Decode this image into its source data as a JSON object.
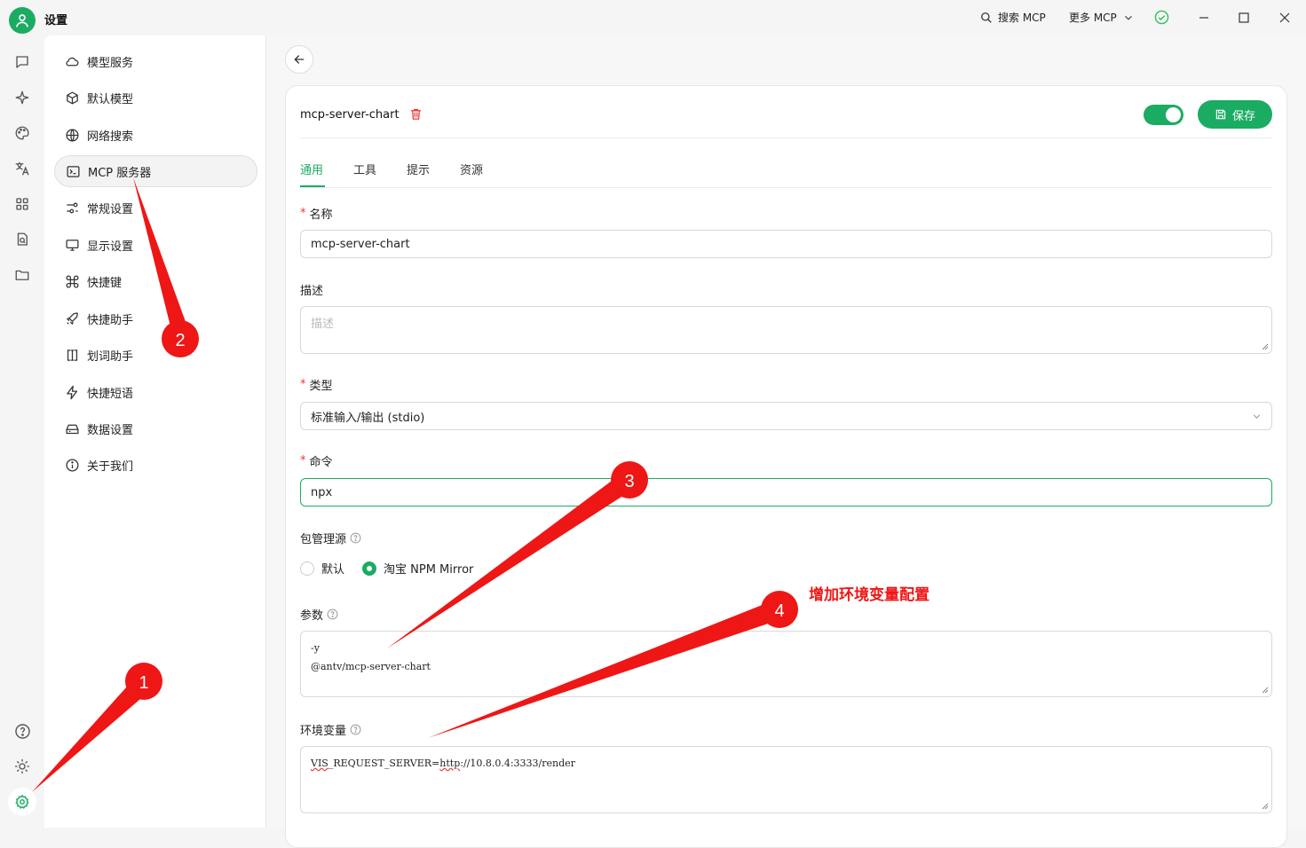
{
  "titlebar": {
    "app_title": "设置",
    "search_mcp": "搜索 MCP",
    "more_mcp": "更多 MCP"
  },
  "settings_nav": {
    "items": [
      {
        "label": "模型服务",
        "icon": "cloud-icon"
      },
      {
        "label": "默认模型",
        "icon": "cube-icon"
      },
      {
        "label": "网络搜索",
        "icon": "globe-icon"
      },
      {
        "label": "MCP 服务器",
        "icon": "terminal-icon"
      },
      {
        "label": "常规设置",
        "icon": "sliders-icon"
      },
      {
        "label": "显示设置",
        "icon": "monitor-icon"
      },
      {
        "label": "快捷键",
        "icon": "command-icon"
      },
      {
        "label": "快捷助手",
        "icon": "rocket-icon"
      },
      {
        "label": "划词助手",
        "icon": "text-cursor-icon"
      },
      {
        "label": "快捷短语",
        "icon": "zap-icon"
      },
      {
        "label": "数据设置",
        "icon": "drive-icon"
      },
      {
        "label": "关于我们",
        "icon": "info-icon"
      }
    ],
    "active_index": 3
  },
  "server": {
    "name": "mcp-server-chart",
    "enabled": true,
    "save_label": "保存"
  },
  "tabs": [
    "通用",
    "工具",
    "提示",
    "资源"
  ],
  "form": {
    "name_label": "名称",
    "name_value": "mcp-server-chart",
    "desc_label": "描述",
    "desc_placeholder": "描述",
    "type_label": "类型",
    "type_value": "标准输入/输出 (stdio)",
    "command_label": "命令",
    "command_value": "npx",
    "pkg_label": "包管理源",
    "pkg_options": [
      "默认",
      "淘宝 NPM Mirror"
    ],
    "pkg_selected": "淘宝 NPM Mirror",
    "args_label": "参数",
    "args_lines": [
      "-y",
      "@antv/mcp-server-chart"
    ],
    "env_label": "环境变量",
    "env_prefix": "VIS",
    "env_mid": "_REQUEST_SERVER=",
    "env_http": "http",
    "env_rest": "://10.8.0.4:3333/render"
  },
  "annotations": {
    "markers": [
      "1",
      "2",
      "3",
      "4"
    ],
    "note": "增加环境变量配置"
  },
  "colors": {
    "accent": "#1aac62",
    "annotation_red": "#ef1616"
  }
}
